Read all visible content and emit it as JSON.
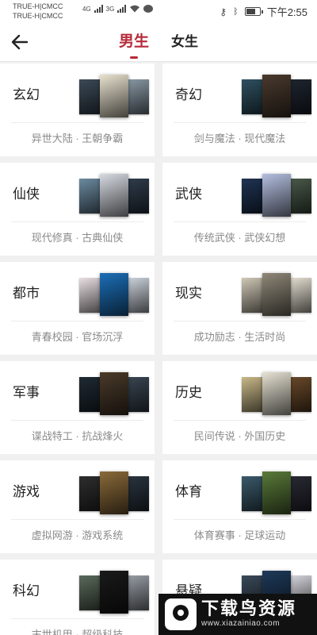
{
  "status_bar": {
    "carrier_1": "TRUE-H|CMCC",
    "carrier_2": "TRUE-H|CMCC",
    "net_1": "4G",
    "net_2": "3G",
    "time": "下午2:55",
    "battery_level": 0.75,
    "icons": [
      "signal-4g-icon",
      "signal-3g-icon",
      "wifi-icon",
      "message-icon",
      "key-icon",
      "bluetooth-icon",
      "battery-icon"
    ]
  },
  "header": {
    "back_icon": "arrow-left-icon",
    "tabs": [
      {
        "label": "男生",
        "active": true
      },
      {
        "label": "女生",
        "active": false
      }
    ],
    "accent_color": "#b72a3a"
  },
  "categories": [
    {
      "name": "玄幻",
      "desc": "异世大陆 · 王朝争霸",
      "covers": [
        "#3b4a56",
        "#e9e2cf",
        "#8a9aa6"
      ]
    },
    {
      "name": "奇幻",
      "desc": "剑与魔法 · 现代魔法",
      "covers": [
        "#2e5060",
        "#4a3a2e",
        "#1f2630"
      ]
    },
    {
      "name": "仙侠",
      "desc": "现代修真 · 古典仙侠",
      "covers": [
        "#6b8aa0",
        "#d7dbe2",
        "#2f3d4c"
      ]
    },
    {
      "name": "武侠",
      "desc": "传统武侠 · 武侠幻想",
      "covers": [
        "#1f3352",
        "#b4bfe0",
        "#4a5a4a"
      ]
    },
    {
      "name": "都市",
      "desc": "青春校园 · 官场沉浮",
      "covers": [
        "#e9dfe3",
        "#1c6fb8",
        "#cfd6df"
      ]
    },
    {
      "name": "现实",
      "desc": "成功励志 · 生活时尚",
      "covers": [
        "#cfc7b5",
        "#8f8878",
        "#e8e2d4"
      ]
    },
    {
      "name": "军事",
      "desc": "谍战特工 · 抗战烽火",
      "covers": [
        "#1f2a33",
        "#4a3a2a",
        "#3a4652"
      ]
    },
    {
      "name": "历史",
      "desc": "民间传说 · 外国历史",
      "covers": [
        "#c8b888",
        "#e7e2d4",
        "#6a4a2a"
      ]
    },
    {
      "name": "游戏",
      "desc": "虚拟网游 · 游戏系统",
      "covers": [
        "#2e2e2e",
        "#8a6a3a",
        "#2a3540"
      ]
    },
    {
      "name": "体育",
      "desc": "体育赛事 · 足球运动",
      "covers": [
        "#3a5a6a",
        "#5a7a3a",
        "#2a2a35"
      ]
    },
    {
      "name": "科幻",
      "desc": "末世机甲 · 超级科技",
      "covers": [
        "#5a6a5a",
        "#1a1a1a",
        "#9aa0a8"
      ]
    },
    {
      "name": "悬疑",
      "desc": "",
      "covers": [
        "#3a4a5a",
        "#1e3a5a",
        "#d8d8e0"
      ]
    }
  ],
  "watermark": {
    "title": "下载鸟资源",
    "url": "www.xiazainiao.com"
  }
}
